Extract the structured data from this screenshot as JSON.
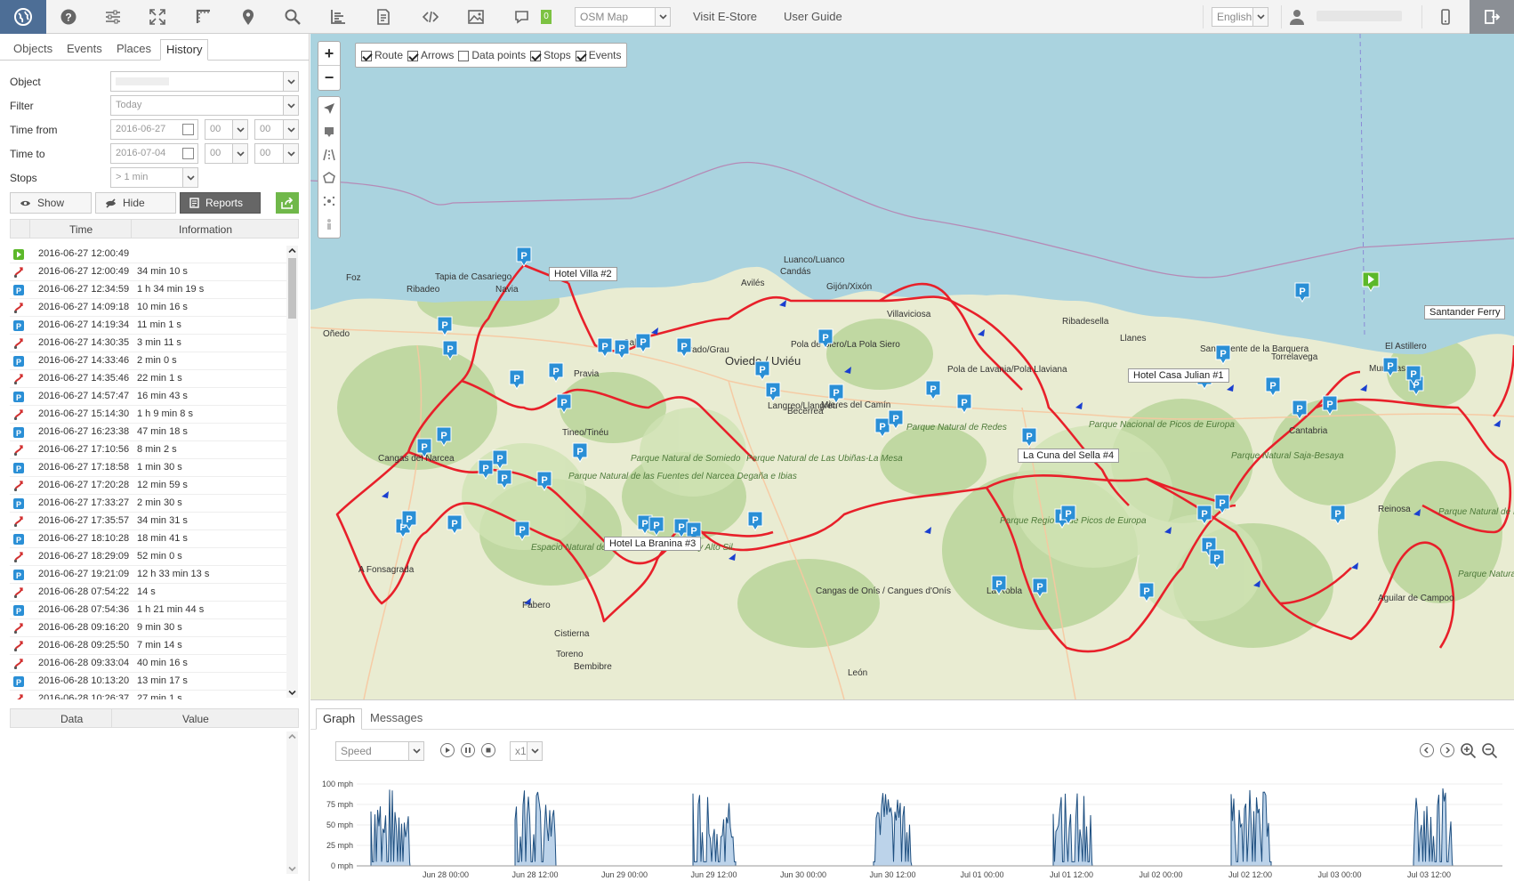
{
  "toolbar": {
    "map_select": "OSM Map",
    "visit_store": "Visit E-Store",
    "user_guide": "User Guide",
    "language": "English",
    "chat_count": "0"
  },
  "left_tabs": [
    "Objects",
    "Events",
    "Places",
    "History"
  ],
  "form": {
    "object_label": "Object",
    "filter_label": "Filter",
    "filter_value": "Today",
    "time_from_label": "Time from",
    "time_from_date": "2016-06-27",
    "time_from_h": "00",
    "time_from_m": "00",
    "time_to_label": "Time to",
    "time_to_date": "2016-07-04",
    "time_to_h": "00",
    "time_to_m": "00",
    "stops_label": "Stops",
    "stops_value": "> 1 min"
  },
  "buttons": {
    "show": "Show",
    "hide": "Hide",
    "reports": "Reports"
  },
  "history_columns": {
    "time": "Time",
    "info": "Information"
  },
  "history": [
    {
      "type": "start",
      "time": "2016-06-27 12:00:49",
      "info": ""
    },
    {
      "type": "route",
      "time": "2016-06-27 12:00:49",
      "info": "34 min 10 s"
    },
    {
      "type": "stop",
      "time": "2016-06-27 12:34:59",
      "info": "1 h 34 min 19 s"
    },
    {
      "type": "route",
      "time": "2016-06-27 14:09:18",
      "info": "10 min 16 s"
    },
    {
      "type": "stop",
      "time": "2016-06-27 14:19:34",
      "info": "11 min 1 s"
    },
    {
      "type": "route",
      "time": "2016-06-27 14:30:35",
      "info": "3 min 11 s"
    },
    {
      "type": "stop",
      "time": "2016-06-27 14:33:46",
      "info": "2 min 0 s"
    },
    {
      "type": "route",
      "time": "2016-06-27 14:35:46",
      "info": "22 min 1 s"
    },
    {
      "type": "stop",
      "time": "2016-06-27 14:57:47",
      "info": "16 min 43 s"
    },
    {
      "type": "route",
      "time": "2016-06-27 15:14:30",
      "info": "1 h 9 min 8 s"
    },
    {
      "type": "stop",
      "time": "2016-06-27 16:23:38",
      "info": "47 min 18 s"
    },
    {
      "type": "route",
      "time": "2016-06-27 17:10:56",
      "info": "8 min 2 s"
    },
    {
      "type": "stop",
      "time": "2016-06-27 17:18:58",
      "info": "1 min 30 s"
    },
    {
      "type": "route",
      "time": "2016-06-27 17:20:28",
      "info": "12 min 59 s"
    },
    {
      "type": "stop",
      "time": "2016-06-27 17:33:27",
      "info": "2 min 30 s"
    },
    {
      "type": "route",
      "time": "2016-06-27 17:35:57",
      "info": "34 min 31 s"
    },
    {
      "type": "stop",
      "time": "2016-06-27 18:10:28",
      "info": "18 min 41 s"
    },
    {
      "type": "route",
      "time": "2016-06-27 18:29:09",
      "info": "52 min 0 s"
    },
    {
      "type": "stop",
      "time": "2016-06-27 19:21:09",
      "info": "12 h 33 min 13 s"
    },
    {
      "type": "route",
      "time": "2016-06-28 07:54:22",
      "info": "14 s"
    },
    {
      "type": "stop",
      "time": "2016-06-28 07:54:36",
      "info": "1 h 21 min 44 s"
    },
    {
      "type": "route",
      "time": "2016-06-28 09:16:20",
      "info": "9 min 30 s"
    },
    {
      "type": "route",
      "time": "2016-06-28 09:25:50",
      "info": "7 min 14 s"
    },
    {
      "type": "route",
      "time": "2016-06-28 09:33:04",
      "info": "40 min 16 s"
    },
    {
      "type": "stop",
      "time": "2016-06-28 10:13:20",
      "info": "13 min 17 s"
    },
    {
      "type": "route",
      "time": "2016-06-28 10:26:37",
      "info": "27 min 1 s"
    }
  ],
  "data_columns": {
    "data": "Data",
    "value": "Value"
  },
  "map": {
    "layers": [
      {
        "label": "Route",
        "checked": true
      },
      {
        "label": "Arrows",
        "checked": true
      },
      {
        "label": "Data points",
        "checked": false
      },
      {
        "label": "Stops",
        "checked": true
      },
      {
        "label": "Events",
        "checked": true
      }
    ],
    "hotels": [
      "Hotel Villa #2",
      "Hotel Casa Julian #1",
      "La Cuna del Sella #4",
      "Hotel La Branina #3",
      "Santander Ferry"
    ],
    "places": [
      "Tapia de Casariego",
      "Navia",
      "Ribadeo",
      "Foz",
      "Luanco/Luanco",
      "Candás",
      "Avilés",
      "Gijón/Xixón",
      "Villaviciosa",
      "Ribadesella",
      "Llanes",
      "San Vicente de la Barquera",
      "Torrelavega",
      "Muriedas",
      "El Astillero",
      "Oviedo / Uviéu",
      "Pola de Siero/La Pola Siero",
      "Grado/Grau",
      "Salas",
      "Pravia",
      "Tineo/Tinéu",
      "Cangas del Narcea",
      "A Fonsagrada",
      "Becerreá",
      "Langreo/Llangréu",
      "Mieres del Camín",
      "Pola de Lavania/Pola Llaviana",
      "Cangas de Onís / Cangues d'Onís",
      "La Robla",
      "Cistierna",
      "Reinosa",
      "Toreno",
      "Bembibre",
      "León",
      "Aguilar de Campoo",
      "Cantabria",
      "Parque Nacional de Picos de Europa",
      "Parque Natural Saja-Besaya",
      "Espacio Natural de los Ancares Leoneses y Alto Sil",
      "Parque Natural de las Fuentes del Narcea Degaña e Ibias",
      "Parque Natural de Fuentes Carrionas y Fuente Cobre-Montaña Palentina",
      "Parque Natural de Redes",
      "Parque Natural de Somiedo",
      "Parque Natural de Las Ubiñas-La Mesa",
      "Parque Regional de Picos de Europa",
      "Parque Natural Hoces del Alto Ebro y Rudrón",
      "Fabero",
      "Oñedo"
    ]
  },
  "bottom_tabs": [
    "Graph",
    "Messages"
  ],
  "graph": {
    "metric": "Speed",
    "speed_mult": "x1",
    "y_labels": [
      "100 mph",
      "75 mph",
      "50 mph",
      "25 mph",
      "0 mph"
    ],
    "x_labels": [
      "Jun 28 00:00",
      "Jun 28 12:00",
      "Jun 29 00:00",
      "Jun 29 12:00",
      "Jun 30 00:00",
      "Jun 30 12:00",
      "Jul 01 00:00",
      "Jul 01 12:00",
      "Jul 02 00:00",
      "Jul 02 12:00",
      "Jul 03 00:00",
      "Jul 03 12:00"
    ],
    "accent": "#1e4f80"
  },
  "colors": {
    "route": "#e8202a",
    "stop_marker": "#2a8fd6",
    "start_marker": "#5cb82a",
    "sea": "#aad3df",
    "land": "#e9ecd2"
  }
}
